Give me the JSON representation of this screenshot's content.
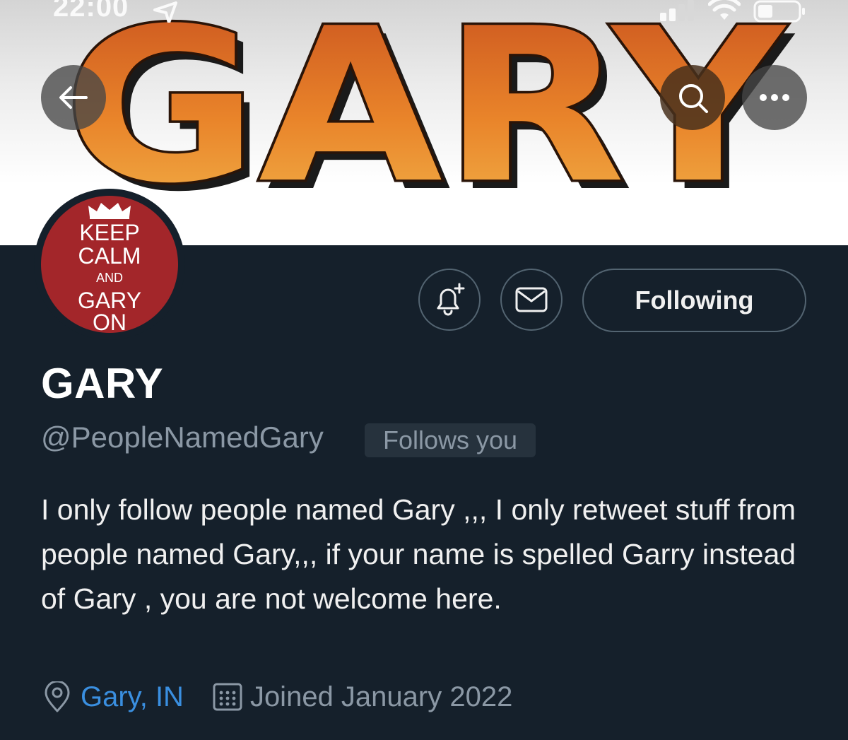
{
  "status_bar": {
    "time": "22:00"
  },
  "banner": {
    "title": "GARY"
  },
  "header": {
    "back_icon": "arrow-left-icon",
    "search_icon": "search-icon",
    "more_icon": "more-horizontal-icon"
  },
  "avatar": {
    "lines": [
      "KEEP",
      "CALM",
      "AND",
      "GARY",
      "ON"
    ],
    "background": "#a3262a"
  },
  "actions": {
    "notify_icon": "bell-plus-icon",
    "message_icon": "envelope-icon",
    "follow_label": "Following"
  },
  "profile": {
    "display_name": "GARY",
    "handle": "@PeopleNamedGary",
    "follows_you": "Follows you",
    "bio": "I only follow people named Gary ,,, I only retweet stuff from people named Gary,,, if your name is spelled Garry instead of Gary , you are not welcome here.",
    "location": "Gary, IN",
    "joined": "Joined January 2022"
  },
  "colors": {
    "background": "#15202b",
    "link": "#3a8fe0",
    "muted": "#8b98a5",
    "banner_orange": "#e98a2b"
  }
}
